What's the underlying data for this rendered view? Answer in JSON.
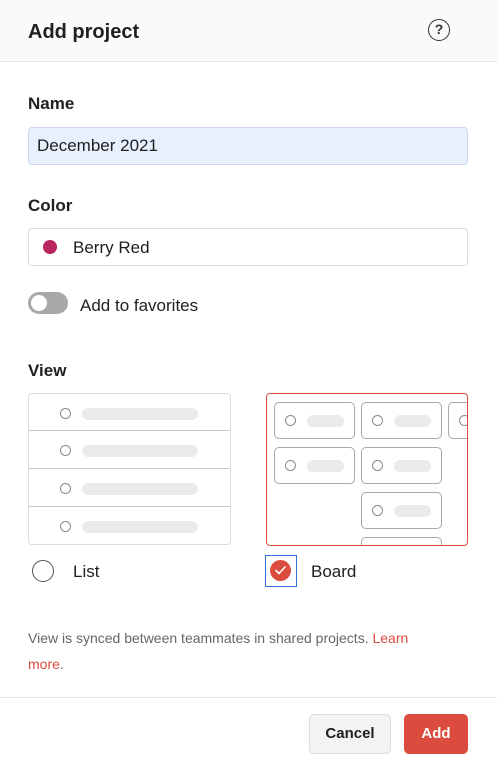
{
  "header": {
    "title": "Add project",
    "help_glyph": "?"
  },
  "name": {
    "label": "Name",
    "value": "December 2021"
  },
  "color": {
    "label": "Color",
    "selected": "Berry Red",
    "swatch": "#b8255f"
  },
  "favorites": {
    "label": "Add to favorites",
    "enabled": false
  },
  "view": {
    "label": "View",
    "options": [
      {
        "label": "List",
        "selected": false
      },
      {
        "label": "Board",
        "selected": true
      }
    ]
  },
  "info": {
    "text": "View is synced between teammates in shared projects. ",
    "link_line1": "Learn",
    "link_line2": "more",
    "period": "."
  },
  "footer": {
    "cancel_label": "Cancel",
    "add_label": "Add"
  },
  "colors": {
    "accent": "#db4c3f",
    "focus": "#2f6fd6",
    "input_bg": "#e8f0fe"
  },
  "icons": [
    "help-icon",
    "color-dot-icon",
    "checkmark-icon"
  ]
}
